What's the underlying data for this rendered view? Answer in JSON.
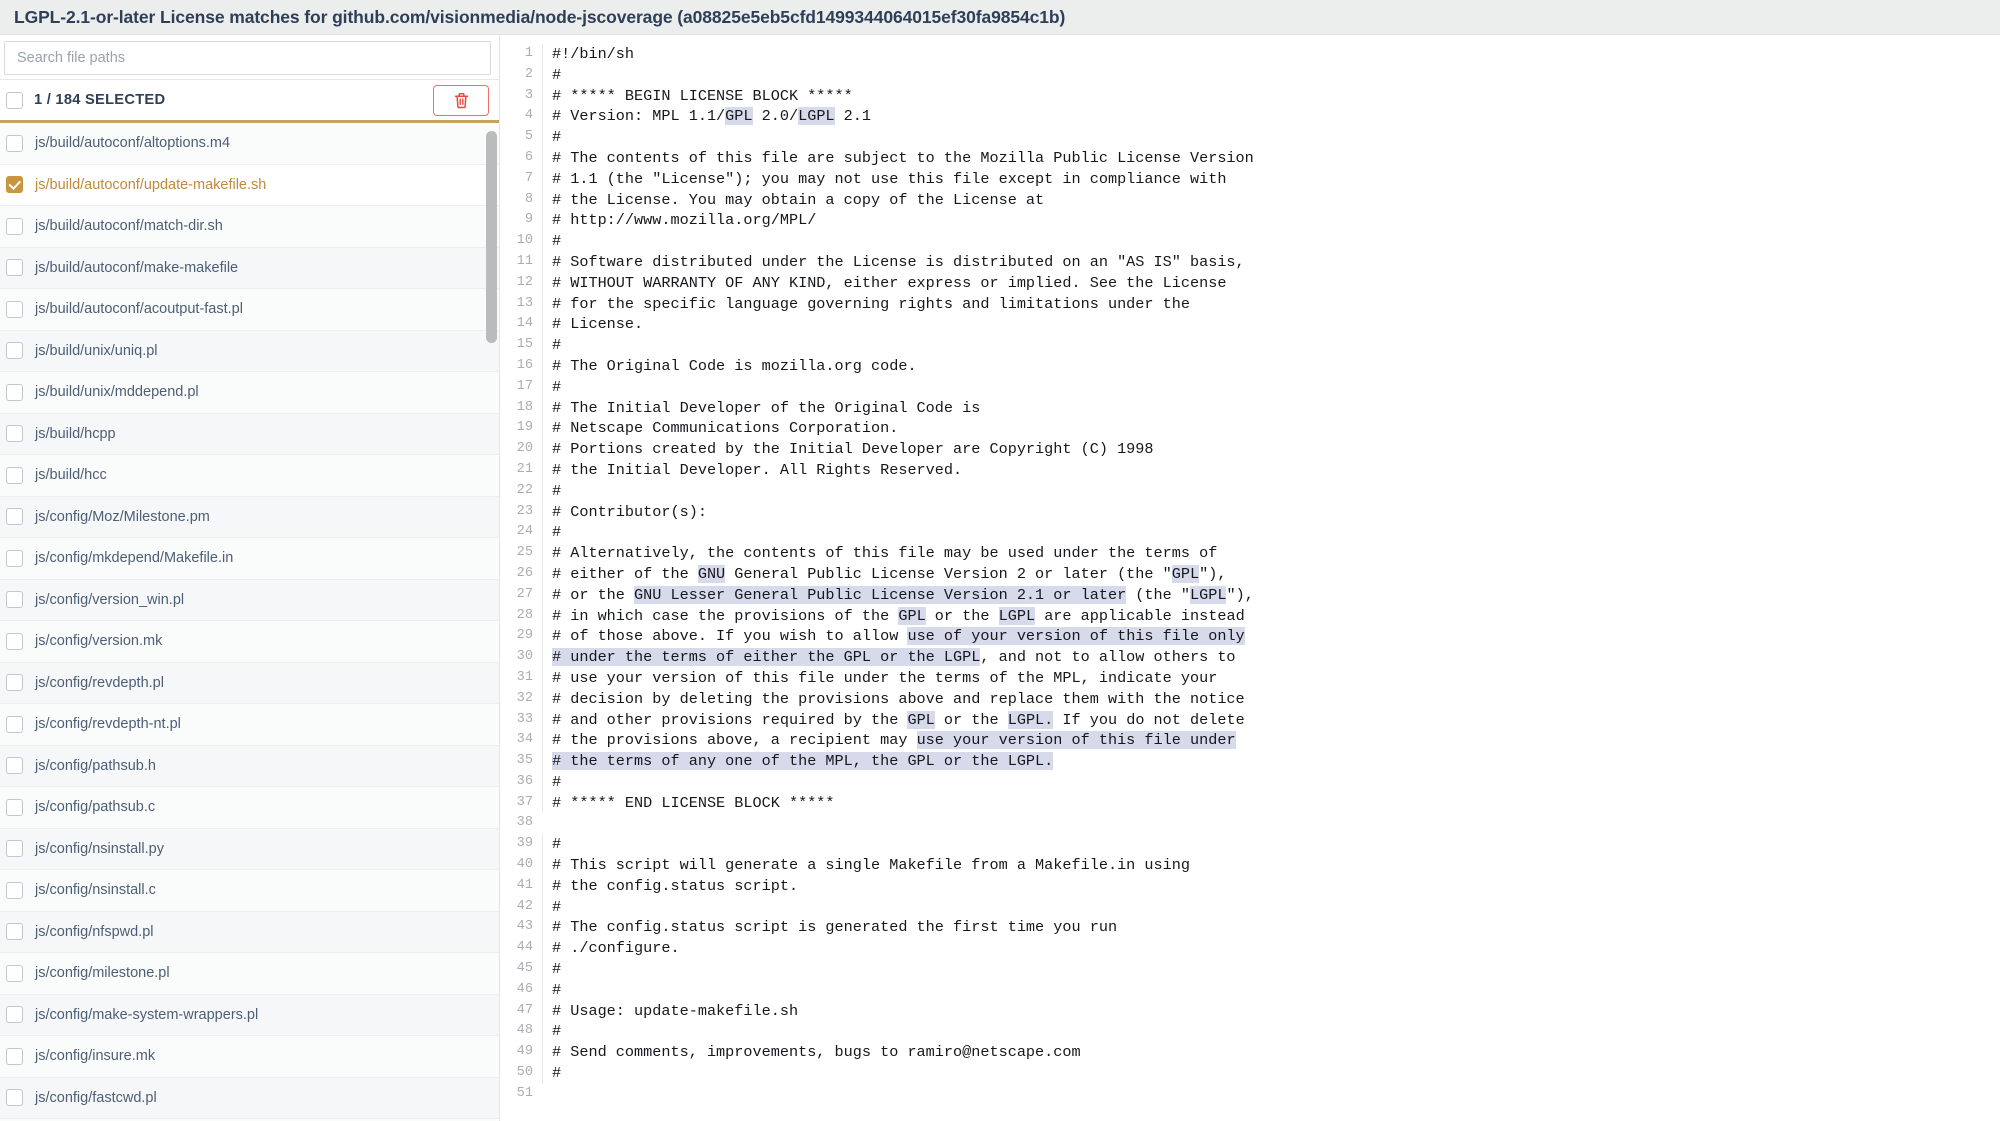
{
  "titlebar": {
    "title": "LGPL-2.1-or-later License matches for github.com/visionmedia/node-jscoverage (a08825e5eb5cfd1499344064015ef30fa9854c1b)"
  },
  "sidebar": {
    "search": {
      "placeholder": "Search file paths",
      "value": ""
    },
    "selection": {
      "label": "1 / 184 SELECTED",
      "selected_count": 1,
      "total_count": 184,
      "header_checkbox_checked": false,
      "delete_icon": "trash-icon",
      "accent_color": "#c9a063",
      "delete_color": "#f46d68"
    },
    "files": [
      {
        "path": "js/build/autoconf/altoptions.m4",
        "selected": false
      },
      {
        "path": "js/build/autoconf/update-makefile.sh",
        "selected": true
      },
      {
        "path": "js/build/autoconf/match-dir.sh",
        "selected": false
      },
      {
        "path": "js/build/autoconf/make-makefile",
        "selected": false
      },
      {
        "path": "js/build/autoconf/acoutput-fast.pl",
        "selected": false
      },
      {
        "path": "js/build/unix/uniq.pl",
        "selected": false
      },
      {
        "path": "js/build/unix/mddepend.pl",
        "selected": false
      },
      {
        "path": "js/build/hcpp",
        "selected": false
      },
      {
        "path": "js/build/hcc",
        "selected": false
      },
      {
        "path": "js/config/Moz/Milestone.pm",
        "selected": false
      },
      {
        "path": "js/config/mkdepend/Makefile.in",
        "selected": false
      },
      {
        "path": "js/config/version_win.pl",
        "selected": false
      },
      {
        "path": "js/config/version.mk",
        "selected": false
      },
      {
        "path": "js/config/revdepth.pl",
        "selected": false
      },
      {
        "path": "js/config/revdepth-nt.pl",
        "selected": false
      },
      {
        "path": "js/config/pathsub.h",
        "selected": false
      },
      {
        "path": "js/config/pathsub.c",
        "selected": false
      },
      {
        "path": "js/config/nsinstall.py",
        "selected": false
      },
      {
        "path": "js/config/nsinstall.c",
        "selected": false
      },
      {
        "path": "js/config/nfspwd.pl",
        "selected": false
      },
      {
        "path": "js/config/milestone.pl",
        "selected": false
      },
      {
        "path": "js/config/make-system-wrappers.pl",
        "selected": false
      },
      {
        "path": "js/config/insure.mk",
        "selected": false
      },
      {
        "path": "js/config/fastcwd.pl",
        "selected": false
      }
    ]
  },
  "code": {
    "highlight_color": "#d7daeb",
    "lines": [
      {
        "n": 1,
        "segments": [
          {
            "t": "#!/bin/sh",
            "h": false
          }
        ]
      },
      {
        "n": 2,
        "segments": [
          {
            "t": "#",
            "h": false
          }
        ]
      },
      {
        "n": 3,
        "segments": [
          {
            "t": "# ***** BEGIN LICENSE BLOCK *****",
            "h": false
          }
        ]
      },
      {
        "n": 4,
        "segments": [
          {
            "t": "# Version: MPL 1.1/",
            "h": false
          },
          {
            "t": "GPL",
            "h": true
          },
          {
            "t": " 2.0/",
            "h": false
          },
          {
            "t": "LGPL",
            "h": true
          },
          {
            "t": " 2.1",
            "h": false
          }
        ]
      },
      {
        "n": 5,
        "segments": [
          {
            "t": "#",
            "h": false
          }
        ]
      },
      {
        "n": 6,
        "segments": [
          {
            "t": "# The contents of this file are subject to the Mozilla Public License Version",
            "h": false
          }
        ]
      },
      {
        "n": 7,
        "segments": [
          {
            "t": "# 1.1 (the \"License\"); you may not use this file except in compliance with",
            "h": false
          }
        ]
      },
      {
        "n": 8,
        "segments": [
          {
            "t": "# the License. You may obtain a copy of the License at",
            "h": false
          }
        ]
      },
      {
        "n": 9,
        "segments": [
          {
            "t": "# http://www.mozilla.org/MPL/",
            "h": false
          }
        ]
      },
      {
        "n": 10,
        "segments": [
          {
            "t": "#",
            "h": false
          }
        ]
      },
      {
        "n": 11,
        "segments": [
          {
            "t": "# Software distributed under the License is distributed on an \"AS IS\" basis,",
            "h": false
          }
        ]
      },
      {
        "n": 12,
        "segments": [
          {
            "t": "# WITHOUT WARRANTY OF ANY KIND, either express or implied. See the License",
            "h": false
          }
        ]
      },
      {
        "n": 13,
        "segments": [
          {
            "t": "# for the specific language governing rights and limitations under the",
            "h": false
          }
        ]
      },
      {
        "n": 14,
        "segments": [
          {
            "t": "# License.",
            "h": false
          }
        ]
      },
      {
        "n": 15,
        "segments": [
          {
            "t": "#",
            "h": false
          }
        ]
      },
      {
        "n": 16,
        "segments": [
          {
            "t": "# The Original Code is mozilla.org code.",
            "h": false
          }
        ]
      },
      {
        "n": 17,
        "segments": [
          {
            "t": "#",
            "h": false
          }
        ]
      },
      {
        "n": 18,
        "segments": [
          {
            "t": "# The Initial Developer of the Original Code is",
            "h": false
          }
        ]
      },
      {
        "n": 19,
        "segments": [
          {
            "t": "# Netscape Communications Corporation.",
            "h": false
          }
        ]
      },
      {
        "n": 20,
        "segments": [
          {
            "t": "# Portions created by the Initial Developer are Copyright (C) 1998",
            "h": false
          }
        ]
      },
      {
        "n": 21,
        "segments": [
          {
            "t": "# the Initial Developer. All Rights Reserved.",
            "h": false
          }
        ]
      },
      {
        "n": 22,
        "segments": [
          {
            "t": "#",
            "h": false
          }
        ]
      },
      {
        "n": 23,
        "segments": [
          {
            "t": "# Contributor(s):",
            "h": false
          }
        ]
      },
      {
        "n": 24,
        "segments": [
          {
            "t": "#",
            "h": false
          }
        ]
      },
      {
        "n": 25,
        "segments": [
          {
            "t": "# Alternatively, the contents of this file may be used under the terms of",
            "h": false
          }
        ]
      },
      {
        "n": 26,
        "segments": [
          {
            "t": "# either of the ",
            "h": false
          },
          {
            "t": "GNU",
            "h": true
          },
          {
            "t": " General Public License Version 2 or later (the \"",
            "h": false
          },
          {
            "t": "GPL",
            "h": true
          },
          {
            "t": "\"),",
            "h": false
          }
        ]
      },
      {
        "n": 27,
        "segments": [
          {
            "t": "# or the ",
            "h": false
          },
          {
            "t": "GNU Lesser General Public License Version 2.1 or later",
            "h": true
          },
          {
            "t": " (the \"",
            "h": false
          },
          {
            "t": "LGPL",
            "h": true
          },
          {
            "t": "\"),",
            "h": false
          }
        ]
      },
      {
        "n": 28,
        "segments": [
          {
            "t": "# in which case the provisions of the ",
            "h": false
          },
          {
            "t": "GPL",
            "h": true
          },
          {
            "t": " or the ",
            "h": false
          },
          {
            "t": "LGPL",
            "h": true
          },
          {
            "t": " are applicable instead",
            "h": false
          }
        ]
      },
      {
        "n": 29,
        "segments": [
          {
            "t": "# of those above. If you wish to allow ",
            "h": false
          },
          {
            "t": "use of your version of this file only",
            "h": true
          }
        ]
      },
      {
        "n": 30,
        "segments": [
          {
            "t": "# under the terms of either the GPL or the LGPL",
            "h": true
          },
          {
            "t": ", and not to allow others to",
            "h": false
          }
        ]
      },
      {
        "n": 31,
        "segments": [
          {
            "t": "# use your version of this file under the terms of the MPL, indicate your",
            "h": false
          }
        ]
      },
      {
        "n": 32,
        "segments": [
          {
            "t": "# decision by deleting the provisions above and replace them with the notice",
            "h": false
          }
        ]
      },
      {
        "n": 33,
        "segments": [
          {
            "t": "# and other provisions required by the ",
            "h": false
          },
          {
            "t": "GPL",
            "h": true
          },
          {
            "t": " or the ",
            "h": false
          },
          {
            "t": "LGPL.",
            "h": true
          },
          {
            "t": " If you do not delete",
            "h": false
          }
        ]
      },
      {
        "n": 34,
        "segments": [
          {
            "t": "# the provisions above, a recipient may ",
            "h": false
          },
          {
            "t": "use your version of this file under",
            "h": true
          }
        ]
      },
      {
        "n": 35,
        "segments": [
          {
            "t": "# the terms of any one of the MPL, the GPL or the LGPL.",
            "h": true
          }
        ]
      },
      {
        "n": 36,
        "segments": [
          {
            "t": "#",
            "h": false
          }
        ]
      },
      {
        "n": 37,
        "segments": [
          {
            "t": "# ***** END LICENSE BLOCK *****",
            "h": false
          }
        ]
      },
      {
        "n": 38,
        "segments": [
          {
            "t": "",
            "h": false
          }
        ]
      },
      {
        "n": 39,
        "segments": [
          {
            "t": "#",
            "h": false
          }
        ]
      },
      {
        "n": 40,
        "segments": [
          {
            "t": "# This script will generate a single Makefile from a Makefile.in using",
            "h": false
          }
        ]
      },
      {
        "n": 41,
        "segments": [
          {
            "t": "# the config.status script.",
            "h": false
          }
        ]
      },
      {
        "n": 42,
        "segments": [
          {
            "t": "#",
            "h": false
          }
        ]
      },
      {
        "n": 43,
        "segments": [
          {
            "t": "# The config.status script is generated the first time you run",
            "h": false
          }
        ]
      },
      {
        "n": 44,
        "segments": [
          {
            "t": "# ./configure.",
            "h": false
          }
        ]
      },
      {
        "n": 45,
        "segments": [
          {
            "t": "#",
            "h": false
          }
        ]
      },
      {
        "n": 46,
        "segments": [
          {
            "t": "#",
            "h": false
          }
        ]
      },
      {
        "n": 47,
        "segments": [
          {
            "t": "# Usage: update-makefile.sh",
            "h": false
          }
        ]
      },
      {
        "n": 48,
        "segments": [
          {
            "t": "#",
            "h": false
          }
        ]
      },
      {
        "n": 49,
        "segments": [
          {
            "t": "# Send comments, improvements, bugs to ramiro@netscape.com",
            "h": false
          }
        ]
      },
      {
        "n": 50,
        "segments": [
          {
            "t": "#",
            "h": false
          }
        ]
      },
      {
        "n": 51,
        "segments": [
          {
            "t": "",
            "h": false
          }
        ]
      }
    ]
  }
}
